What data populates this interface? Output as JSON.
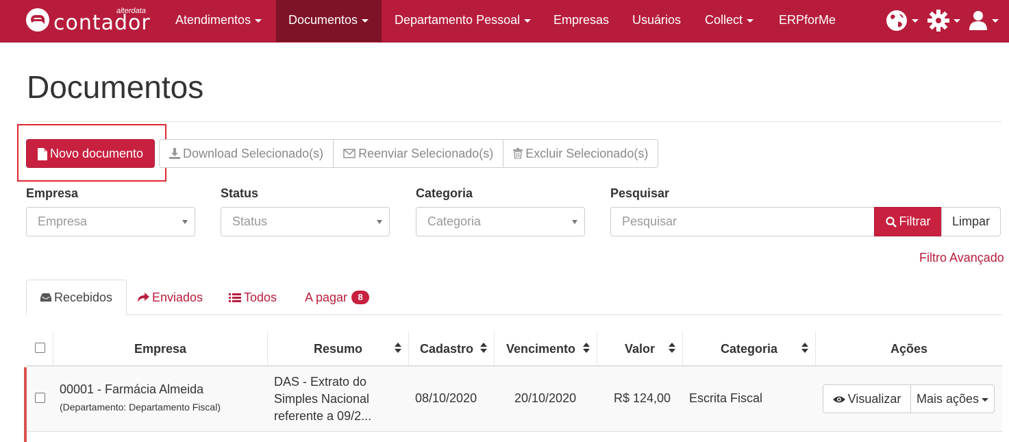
{
  "brand": {
    "name": "contador",
    "sub": "alterdata"
  },
  "nav": {
    "items": [
      {
        "label": "Atendimentos"
      },
      {
        "label": "Documentos"
      },
      {
        "label": "Departamento Pessoal"
      },
      {
        "label": "Empresas"
      },
      {
        "label": "Usuários"
      },
      {
        "label": "Collect"
      },
      {
        "label": "ERPforMe"
      }
    ],
    "icons": [
      "globe-icon",
      "gear-icon",
      "user-icon"
    ]
  },
  "page": {
    "title": "Documentos"
  },
  "toolbar": {
    "new_doc": "Novo documento",
    "download": "Download Selecionado(s)",
    "resend": "Reenviar Selecionado(s)",
    "delete": "Excluir Selecionado(s)"
  },
  "filters": {
    "empresa": {
      "label": "Empresa",
      "placeholder": "Empresa"
    },
    "status": {
      "label": "Status",
      "placeholder": "Status"
    },
    "categoria": {
      "label": "Categoria",
      "placeholder": "Categoria"
    },
    "pesquisar": {
      "label": "Pesquisar",
      "placeholder": "Pesquisar"
    },
    "filter_btn": "Filtrar",
    "clear_btn": "Limpar",
    "advanced": "Filtro Avançado"
  },
  "tabs": [
    {
      "label": "Recebidos"
    },
    {
      "label": "Enviados"
    },
    {
      "label": "Todos"
    },
    {
      "label": "A pagar",
      "badge": "8"
    }
  ],
  "table": {
    "headers": [
      "Empresa",
      "Resumo",
      "Cadastro",
      "Vencimento",
      "Valor",
      "Categoria",
      "Ações"
    ],
    "rows": [
      {
        "empresa": "00001 - Farmácia Almeida",
        "departamento": "(Departamento: Departamento Fiscal)",
        "resumo_1": "DAS - Extrato do",
        "resumo_2": "Simples Nacional",
        "resumo_3": "referente a 09/2...",
        "cadastro": "08/10/2020",
        "vencimento": "20/10/2020",
        "valor": "R$ 124,00",
        "categoria": "Escrita Fiscal",
        "view": "Visualizar",
        "more": "Mais ações"
      }
    ]
  },
  "colors": {
    "brand": "#b71c3c",
    "primary_button": "#c8203f",
    "active_nav": "#7e1226",
    "row_accent": "#d9534f"
  }
}
